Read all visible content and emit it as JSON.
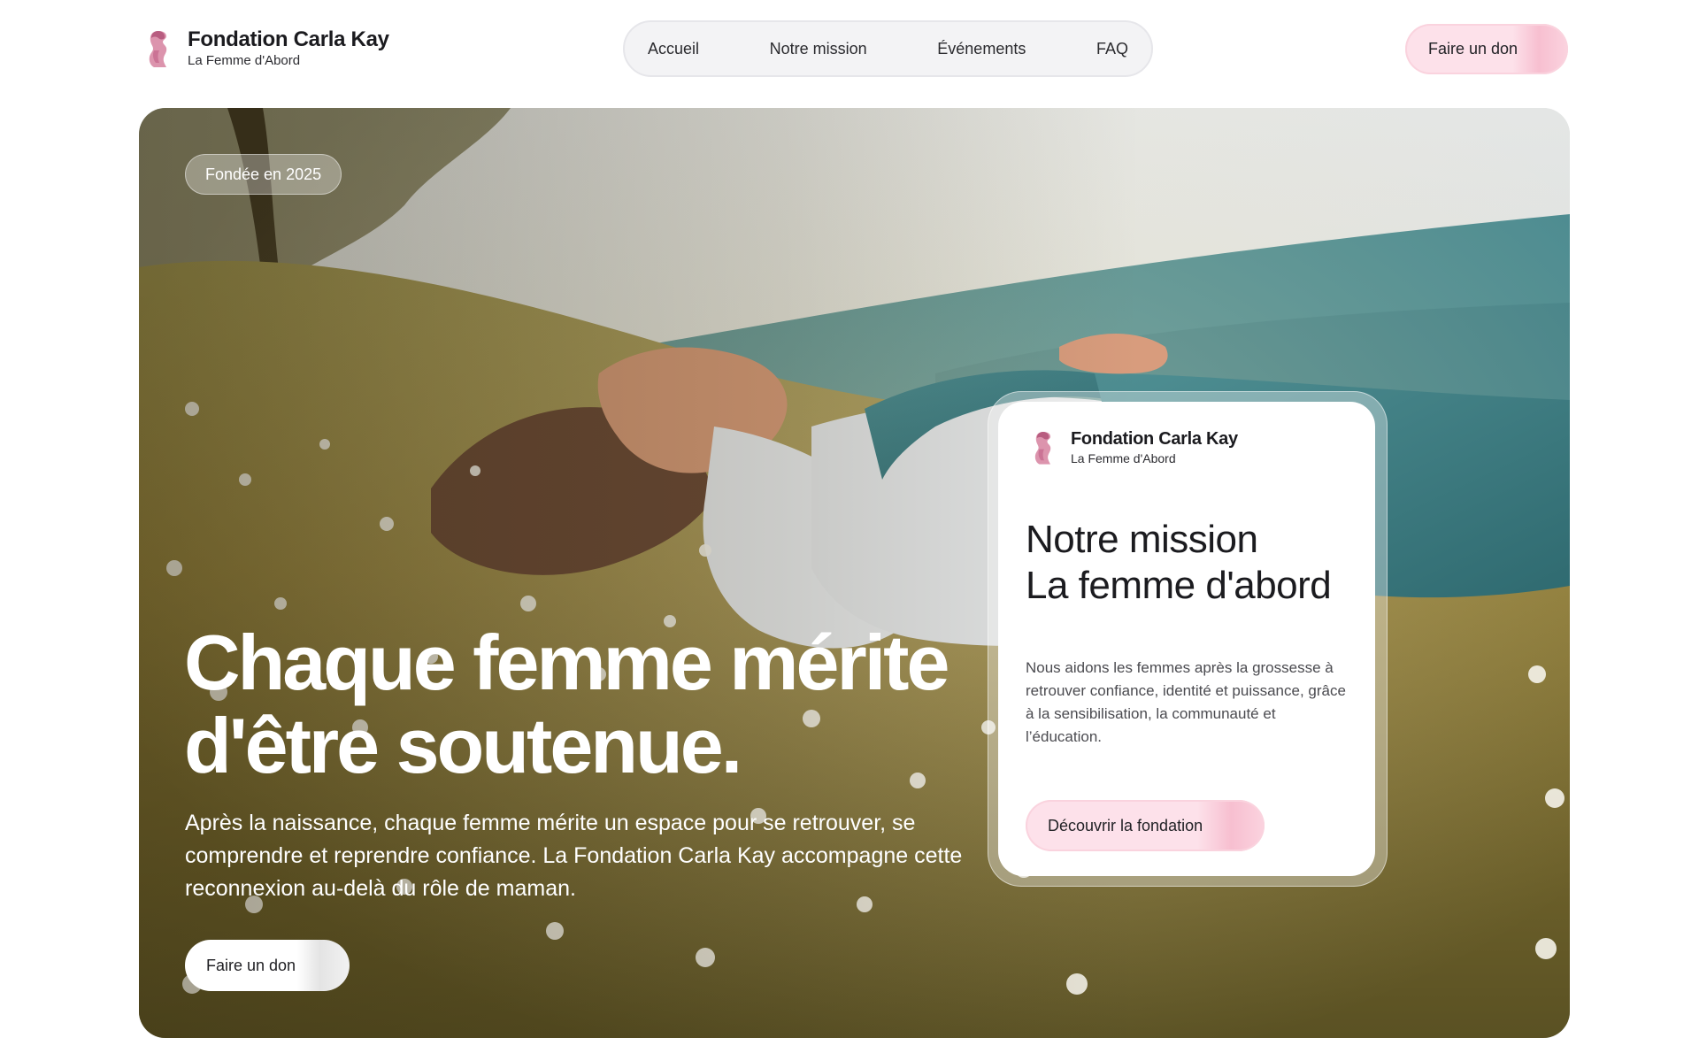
{
  "brand": {
    "name": "Fondation Carla Kay",
    "tagline": "La Femme d'Abord"
  },
  "nav": {
    "items": [
      {
        "label": "Accueil"
      },
      {
        "label": "Notre mission"
      },
      {
        "label": "Événements"
      },
      {
        "label": "FAQ"
      }
    ]
  },
  "header": {
    "donate_label": "Faire un don"
  },
  "hero": {
    "badge": "Fondée en 2025",
    "title_line1": "Chaque femme mérite",
    "title_line2": "d'être soutenue.",
    "description": "Après la naissance, chaque femme mérite un espace pour se retrouver, se comprendre et reprendre confiance. La Fondation Carla Kay accompagne cette reconnexion au-delà du rôle de maman.",
    "donate_label": "Faire un don"
  },
  "mission_card": {
    "brand_name": "Fondation Carla Kay",
    "brand_tagline": "La Femme d'Abord",
    "title_line1": "Notre mission",
    "title_line2": "La femme d'abord",
    "text": "Nous aidons les femmes après la grossesse à retrouver confiance, identité et puissance, grâce à la sensibilisation, la communauté et l’éducation.",
    "cta_label": "Découvrir la fondation"
  },
  "colors": {
    "accent_pink": "#fde1ea",
    "accent_pink_strong": "#f7bfd0",
    "logo_pink": "#d98aa6",
    "text_dark": "#1b1b1f"
  },
  "icons": {
    "logo": "woman-silhouette-logo-icon"
  }
}
